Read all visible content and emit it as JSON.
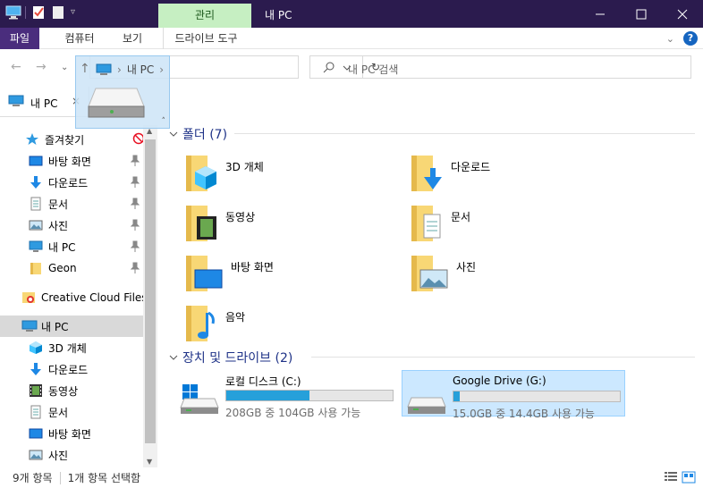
{
  "window": {
    "title": "내 PC",
    "context_tab": "관리",
    "controls": [
      "minimize",
      "maximize",
      "close"
    ]
  },
  "ribbon": {
    "tabs": [
      "파일",
      "컴퓨터",
      "보기",
      "드라이브 도구"
    ]
  },
  "address": {
    "path": "내 PC",
    "search_placeholder": "내 PC 검색"
  },
  "pinned_tab": {
    "label": "내 PC"
  },
  "nav": {
    "quick_access": "즐겨찾기",
    "quick_items": [
      "바탕 화면",
      "다운로드",
      "문서",
      "사진",
      "내 PC",
      "Geon"
    ],
    "creative_cloud": "Creative Cloud Files",
    "this_pc": "내 PC",
    "pc_items": [
      "3D 개체",
      "다운로드",
      "동영상",
      "문서",
      "바탕 화면",
      "사진"
    ]
  },
  "content": {
    "folders_header": "폴더 (7)",
    "folders": [
      "3D 개체",
      "다운로드",
      "동영상",
      "문서",
      "바탕 화면",
      "사진",
      "음악"
    ],
    "drives_header": "장치 및 드라이브 (2)",
    "drives": [
      {
        "name": "로컬 디스크 (C:)",
        "info": "208GB 중 104GB 사용 가능",
        "used_fraction": 0.5
      },
      {
        "name": "Google Drive (G:)",
        "info": "15.0GB 중 14.4GB 사용 가능",
        "used_fraction": 0.04
      }
    ]
  },
  "status": {
    "count": "9개 항목",
    "selected": "1개 항목 선택함"
  },
  "colors": {
    "titlebar": "#2b1b4e",
    "manage_tab": "#c6efc2",
    "file_tab": "#4a2d7d",
    "header_text": "#1e3287",
    "drive_fill": "#26a0da",
    "selection": "#cce8ff"
  }
}
